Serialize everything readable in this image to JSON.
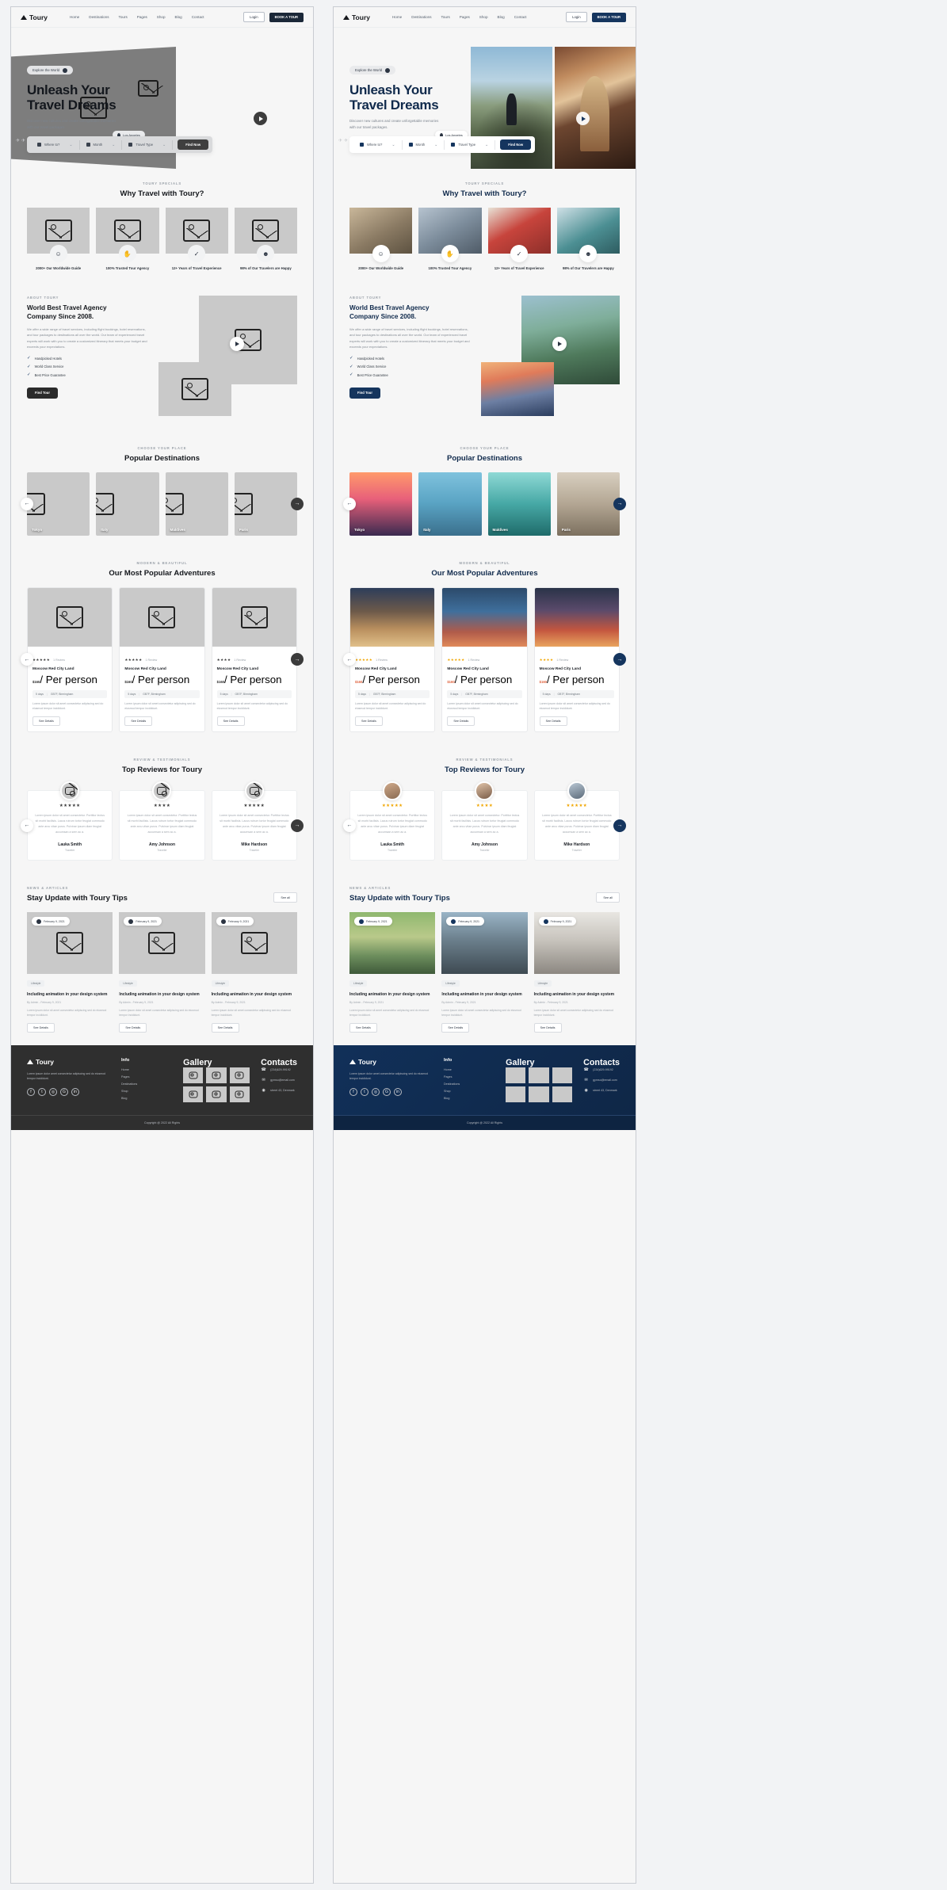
{
  "site": {
    "brand": "Toury",
    "nav": [
      "Home",
      "Destinations",
      "Tours",
      "Pages",
      "Shop",
      "Blog",
      "Contact"
    ],
    "login_label": "Login",
    "book_label": "BOOK A TOUR"
  },
  "hero": {
    "pill": "Explore the World",
    "title_line1": "Unleash Your",
    "title_line2": "Travel Dreams",
    "description": "Discover new cultures and create unforgettable memories with our travel packages.",
    "location_chip": "Los Angeles",
    "search": {
      "where_label": "Where to?",
      "month_label": "Month",
      "type_label": "Travel Type",
      "find_label": "Find Now"
    }
  },
  "specials": {
    "eyebrow": "TOURY SPECIALS",
    "title": "Why Travel with Toury?",
    "items": [
      {
        "icon": "people-icon",
        "glyph": "☺",
        "label": "2000+ Our Worldwide Guide"
      },
      {
        "icon": "handshake-icon",
        "glyph": "✋",
        "label": "100% Trusted Tour Agency"
      },
      {
        "icon": "badge-icon",
        "glyph": "✓",
        "label": "12+ Years of Travel Experience"
      },
      {
        "icon": "smile-icon",
        "glyph": "☻",
        "label": "98% of Our Travelers are Happy"
      }
    ]
  },
  "about": {
    "eyebrow": "ABOUT TOURY",
    "title_line1": "World Best Travel Agency",
    "title_line2": "Company Since 2008.",
    "body": "We offer a wide range of travel services, including flight bookings, hotel reservations, and tour packages to destinations all over the world. Our team of experienced travel experts will work with you to create a customized itinerary that meets your budget and exceeds your expectations.",
    "checks": [
      "Handpicked Hotels",
      "World Class Service",
      "Best Price Guarantee"
    ],
    "cta": "Find Tour"
  },
  "destinations": {
    "eyebrow": "CHOOSE YOUR PLACE",
    "title": "Popular Destinations",
    "items": [
      "Tokyo",
      "Italy",
      "Maldives",
      "Paris"
    ],
    "prev_icon": "arrow-left-icon",
    "next_icon": "arrow-right-icon"
  },
  "adventures": {
    "eyebrow": "MODERN & BEAUTIFUL",
    "title": "Our Most Popular Adventures",
    "items": [
      {
        "stars": "★★★★★",
        "reviews": "1 Review",
        "name": "Moscow Red City Land",
        "price": "$160",
        "per": "/ Per person",
        "days": "5 days",
        "place": "GB7F, Birmingham",
        "desc": "Lorem ipsum dolor sit amet consectetur adipiscing sed do eiusmod tempor incididunt.",
        "cta": "See Details"
      },
      {
        "stars": "★★★★★",
        "reviews": "1 Review",
        "name": "Moscow Red City Land",
        "price": "$160",
        "per": "/ Per person",
        "days": "5 days",
        "place": "GB7F, Birmingham",
        "desc": "Lorem ipsum dolor sit amet consectetur adipiscing sed do eiusmod tempor incididunt.",
        "cta": "See Details"
      },
      {
        "stars": "★★★★",
        "reviews": "1 Review",
        "name": "Moscow Red City Land",
        "price": "$160",
        "per": "/ Per person",
        "days": "5 days",
        "place": "GB7F, Birmingham",
        "desc": "Lorem ipsum dolor sit amet consectetur adipiscing sed do eiusmod tempor incididunt.",
        "cta": "See Details"
      }
    ]
  },
  "reviews": {
    "eyebrow": "REVIEW & TESTIMONIALS",
    "title": "Top Reviews for Toury",
    "items": [
      {
        "stars": "★★★★★",
        "text": "Lorem ipsum dolor sit amet consectetur. Porttitor lectus sit morbi facilisis. Lacus rutrum tortor feugiat commodo ante arcu vitae purus. Pulvinar ipsum diam feugiat accumsan a sem ac a.",
        "name": "Lauka Smith",
        "role": "Traveler"
      },
      {
        "stars": "★★★★",
        "text": "Lorem ipsum dolor sit amet consectetur. Porttitor lectus sit morbi facilisis. Lacus rutrum tortor feugiat commodo ante arcu vitae purus. Pulvinar ipsum diam feugiat accumsan a sem ac a.",
        "name": "Amy Johnson",
        "role": "Traveler"
      },
      {
        "stars": "★★★★★",
        "text": "Lorem ipsum dolor sit amet consectetur. Porttitor lectus sit morbi facilisis. Lacus rutrum tortor feugiat commodo ante arcu vitae purus. Pulvinar ipsum diam feugiat accumsan a sem ac a.",
        "name": "Mike Hardson",
        "role": "Traveler"
      }
    ]
  },
  "news": {
    "eyebrow": "NEWS & ARTICLES",
    "title": "Stay Update with Toury Tips",
    "see_all": "See all",
    "items": [
      {
        "date": "February 9, 2021",
        "category": "Lifestyle",
        "title": "Including animation in your design system",
        "by": "By Admin - February 9, 2021",
        "desc": "Lorem ipsum dolor sit amet consectetur adipiscing sed do eiusmod tempor incididunt.",
        "cta": "See Details"
      },
      {
        "date": "February 9, 2021",
        "category": "Lifestyle",
        "title": "Including animation in your design system",
        "by": "By Admin - February 9, 2021",
        "desc": "Lorem ipsum dolor sit amet consectetur adipiscing sed do eiusmod tempor incididunt.",
        "cta": "See Details"
      },
      {
        "date": "February 9, 2021",
        "category": "Lifestyle",
        "title": "Including animation in your design system",
        "by": "By Admin - February 9, 2021",
        "desc": "Lorem ipsum dolor sit amet consectetur adipiscing sed do eiusmod tempor incididunt.",
        "cta": "See Details"
      }
    ]
  },
  "footer": {
    "brand": "Toury",
    "about": "Lorem ipsum dolor amet consectetur adipiscing sed do eiusmod tempor incididunt.",
    "socials": [
      "facebook-icon",
      "twitter-icon",
      "instagram-icon",
      "google-plus-icon",
      "linkedin-icon"
    ],
    "social_glyphs": [
      "f",
      "t",
      "◎",
      "G",
      "in"
    ],
    "info_title": "Info",
    "info_links": [
      "Home",
      "Pages",
      "Destinations",
      "Shop",
      "Blog"
    ],
    "gallery_title": "Gallery",
    "contacts_title": "Contacts",
    "contacts": [
      {
        "icon": "phone-icon",
        "glyph": "☎",
        "text": "(234)629-99192"
      },
      {
        "icon": "mail-icon",
        "glyph": "✉",
        "text": "gymso@email.com"
      },
      {
        "icon": "location-icon",
        "glyph": "◉",
        "text": "street 43, Denmark"
      }
    ],
    "copyright": "Copyright @ 2022 All Rights"
  },
  "colors": {
    "accent_dark": "#15355e",
    "wire_dark": "#2f2f2f",
    "price": "#e0623d",
    "star": "#f0a500"
  }
}
